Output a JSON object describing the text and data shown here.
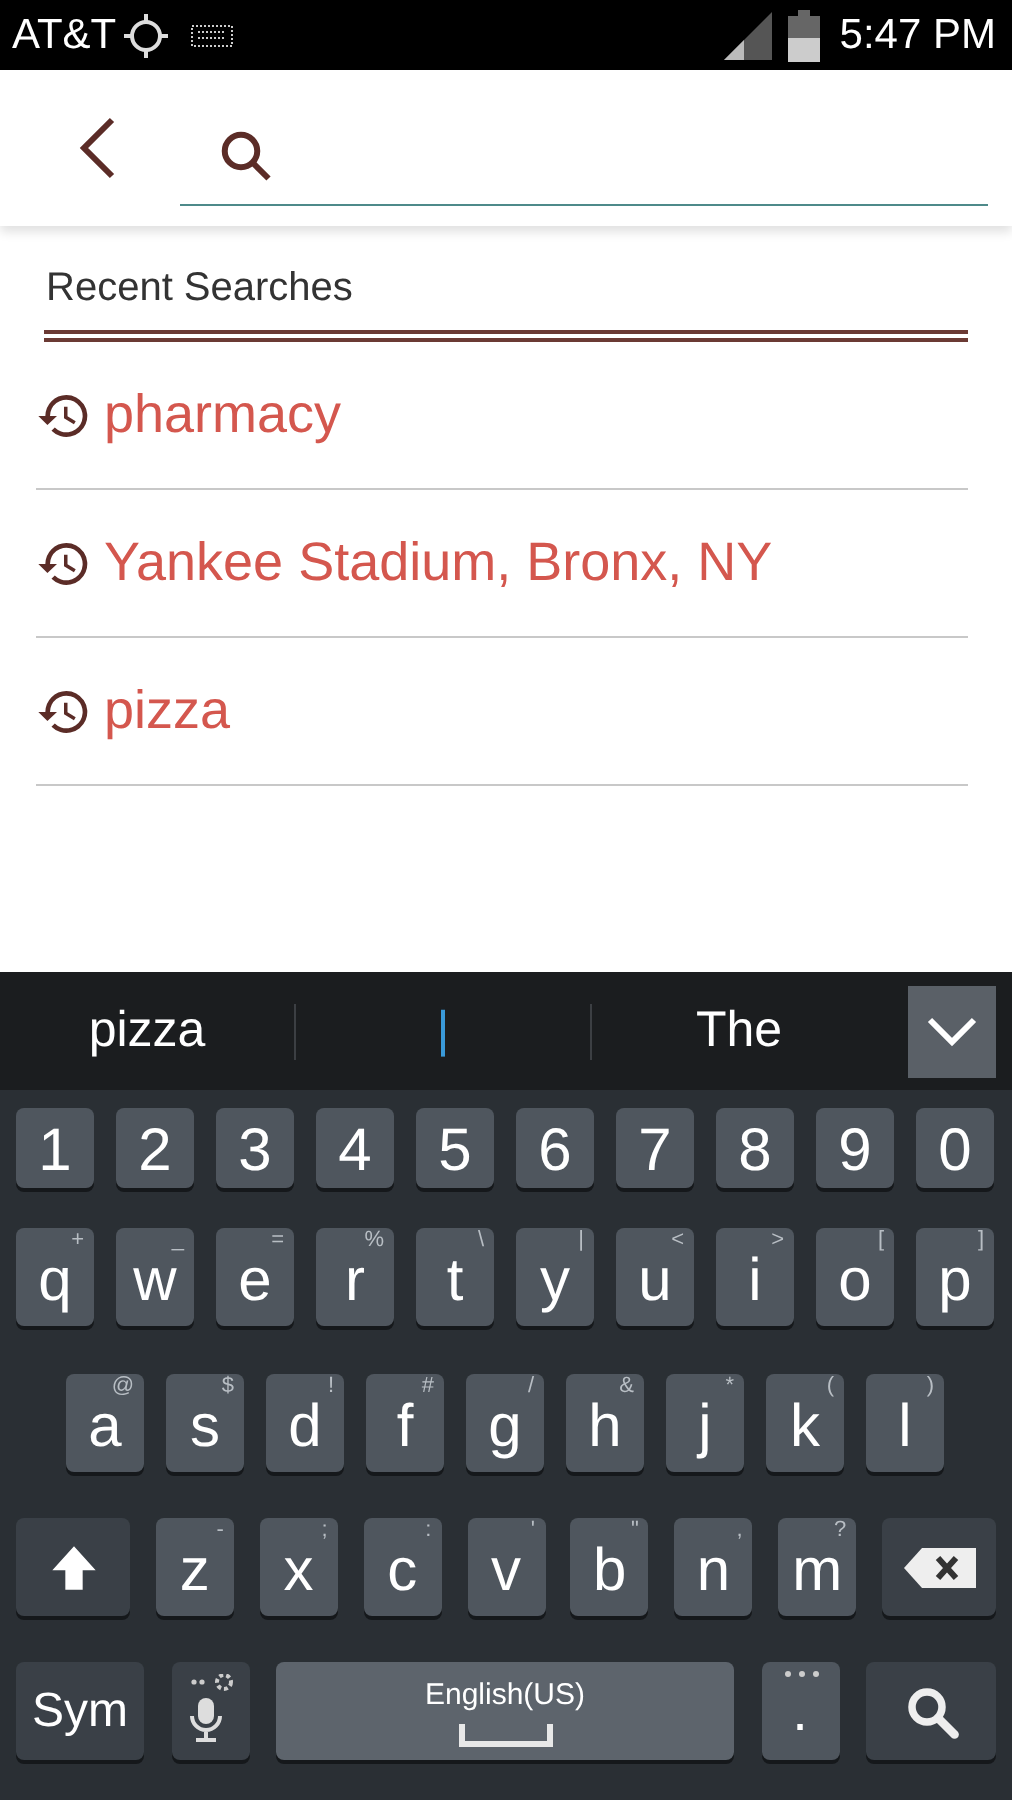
{
  "status_bar": {
    "carrier": "AT&T",
    "time": "5:47 PM"
  },
  "recent": {
    "title": "Recent Searches",
    "items": [
      "pharmacy",
      "Yankee Stadium, Bronx, NY",
      "pizza"
    ]
  },
  "keyboard": {
    "suggestions": [
      {
        "text": "pizza",
        "kind": "word"
      },
      {
        "text": "|",
        "kind": "typed"
      },
      {
        "text": "The",
        "kind": "word"
      }
    ],
    "key_rows": [
      {
        "keys": [
          {
            "label": "1"
          },
          {
            "label": "2"
          },
          {
            "label": "3"
          },
          {
            "label": "4"
          },
          {
            "label": "5"
          },
          {
            "label": "6"
          },
          {
            "label": "7"
          },
          {
            "label": "8"
          },
          {
            "label": "9"
          },
          {
            "label": "0"
          }
        ]
      },
      {
        "keys": [
          {
            "label": "q",
            "hint": "+"
          },
          {
            "label": "w",
            "hint": "_"
          },
          {
            "label": "e",
            "hint": "="
          },
          {
            "label": "r",
            "hint": "%"
          },
          {
            "label": "t",
            "hint": "\\"
          },
          {
            "label": "y",
            "hint": "|"
          },
          {
            "label": "u",
            "hint": "<"
          },
          {
            "label": "i",
            "hint": ">"
          },
          {
            "label": "o",
            "hint": "["
          },
          {
            "label": "p",
            "hint": "]"
          }
        ]
      },
      {
        "keys": [
          {
            "label": "a",
            "hint": "@"
          },
          {
            "label": "s",
            "hint": "$"
          },
          {
            "label": "d",
            "hint": "!"
          },
          {
            "label": "f",
            "hint": "#"
          },
          {
            "label": "g",
            "hint": "/"
          },
          {
            "label": "h",
            "hint": "&"
          },
          {
            "label": "j",
            "hint": "*"
          },
          {
            "label": "k",
            "hint": "("
          },
          {
            "label": "l",
            "hint": ")"
          }
        ]
      },
      {
        "keys": [
          {
            "kind": "shift"
          },
          {
            "label": "z",
            "hint": "-"
          },
          {
            "label": "x",
            "hint": ";"
          },
          {
            "label": "c",
            "hint": ":"
          },
          {
            "label": "v",
            "hint": "'"
          },
          {
            "label": "b",
            "hint": "\""
          },
          {
            "label": "n",
            "hint": ","
          },
          {
            "label": "m",
            "hint": "?"
          },
          {
            "kind": "backspace"
          }
        ]
      }
    ],
    "bottom_row": [
      {
        "kind": "sym",
        "label": "Sym"
      },
      {
        "kind": "mic"
      },
      {
        "kind": "space",
        "label": "English(US)"
      },
      {
        "kind": "period",
        "label": "."
      },
      {
        "kind": "search"
      }
    ]
  }
}
